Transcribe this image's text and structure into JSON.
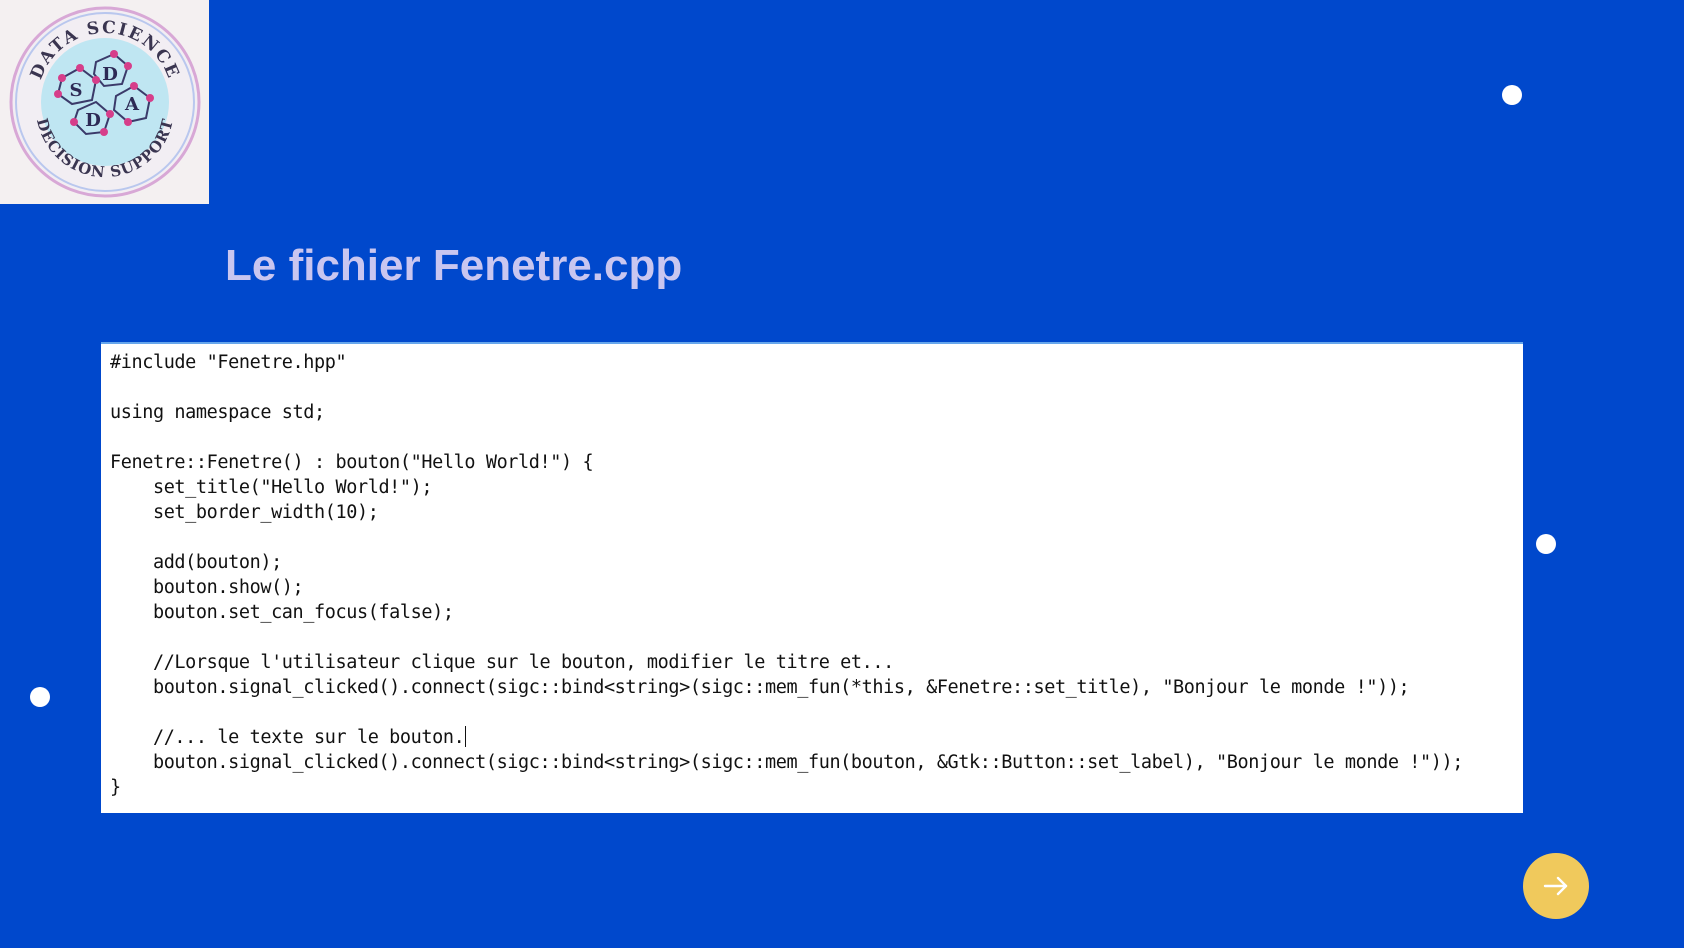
{
  "logo": {
    "icon": "data-science-decision-support-logo",
    "top_text": "DATA SCIENCE",
    "bottom_text": "DECISION SUPPORT",
    "letters": [
      "S",
      "D",
      "D",
      "A"
    ]
  },
  "slide": {
    "title": "Le fichier Fenetre.cpp",
    "title_color": "#c9c6f0",
    "background_color": "#0048cc",
    "accent_color": "#f0c95c"
  },
  "code": {
    "lines": [
      "#include \"Fenetre.hpp\"",
      "",
      "using namespace std;",
      "",
      "Fenetre::Fenetre() : bouton(\"Hello World!\") {",
      "    set_title(\"Hello World!\");",
      "    set_border_width(10);",
      "",
      "    add(bouton);",
      "    bouton.show();",
      "    bouton.set_can_focus(false);",
      "",
      "    //Lorsque l'utilisateur clique sur le bouton, modifier le titre et...",
      "    bouton.signal_clicked().connect(sigc::bind<string>(sigc::mem_fun(*this, &Fenetre::set_title), \"Bonjour le monde !\"));",
      "",
      "    //... le texte sur le bouton.",
      "    bouton.signal_clicked().connect(sigc::bind<string>(sigc::mem_fun(bouton, &Gtk::Button::set_label), \"Bonjour le monde !\"));",
      "}"
    ]
  },
  "navigation": {
    "next_icon": "arrow-right-icon"
  }
}
